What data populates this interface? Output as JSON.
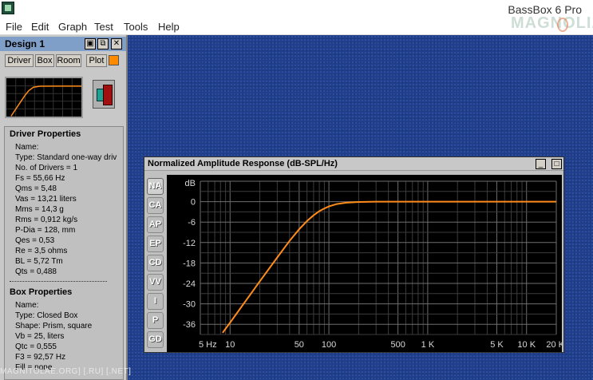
{
  "app": {
    "title": "BassBox 6 Pro",
    "watermark_logo": "MAGNOLIA"
  },
  "menu": [
    "File",
    "Edit",
    "Graph",
    "Test",
    "Tools",
    "Help"
  ],
  "design_panel": {
    "title": "Design 1",
    "window_buttons": [
      "▣",
      "⧉",
      "✕"
    ],
    "tabs": [
      "Driver",
      "Box",
      "Room",
      "Plot"
    ],
    "plot_color": "#ff8a00"
  },
  "driver_properties": {
    "heading": "Driver Properties",
    "lines": [
      "Name:",
      "Type: Standard one-way driv",
      "No. of Drivers = 1",
      "Fs = 55,66 Hz",
      "Qms = 5,48",
      "Vas = 13,21 liters",
      "Mms = 14,3 g",
      "Rms = 0,912 kg/s",
      "P-Dia = 128, mm",
      "Qes = 0,53",
      "Re = 3,5 ohms",
      "BL = 5,72 Tm",
      "Qts = 0,488"
    ]
  },
  "box_properties": {
    "heading": "Box Properties",
    "lines": [
      "Name:",
      "Type: Closed Box",
      "Shape: Prism, square",
      "Vb = 25, liters",
      "Qtc = 0,555",
      "F3 = 92,57 Hz",
      "Fill = none"
    ]
  },
  "footer_watermark": "MAGNITOLAE.ORG] [.RU] [.NET]",
  "graph_window": {
    "title": "Normalized Amplitude Response (dB-SPL/Hz)",
    "window_buttons": [
      "_",
      "□",
      "✕"
    ],
    "side_tabs": [
      "NA",
      "CA",
      "AP",
      "EP",
      "CD",
      "VV",
      "I",
      "P",
      "GD"
    ],
    "active_tab": "NA"
  },
  "chart_data": {
    "type": "line",
    "title": "Normalized Amplitude Response (dB-SPL/Hz)",
    "x_scale": "log",
    "xlim": [
      5,
      20000
    ],
    "ylim": [
      -39,
      6
    ],
    "x_tick_labels": [
      {
        "value": 5,
        "label": "5 Hz"
      },
      {
        "value": 10,
        "label": "10"
      },
      {
        "value": 50,
        "label": "50"
      },
      {
        "value": 100,
        "label": "100"
      },
      {
        "value": 500,
        "label": "500"
      },
      {
        "value": 1000,
        "label": "1 K"
      },
      {
        "value": 5000,
        "label": "5 K"
      },
      {
        "value": 10000,
        "label": "10 K"
      },
      {
        "value": 20000,
        "label": "20 K"
      }
    ],
    "y_unit_label": "dB",
    "y_ticks": [
      0,
      -6,
      -12,
      -18,
      -24,
      -30,
      -36
    ],
    "y_tick_labels": [
      "0",
      "-6",
      "-12",
      "-18",
      "-24",
      "-30",
      "-36"
    ],
    "grid": true,
    "line_color": "#ff8c1a",
    "series": [
      {
        "x": [
          8.4,
          10,
          15,
          20,
          30,
          40,
          50,
          60,
          70,
          80,
          90,
          100,
          120,
          150,
          200,
          300,
          500,
          1000,
          5000,
          10000,
          20000
        ],
        "y": [
          -38.5,
          -35.5,
          -28.4,
          -23.4,
          -16.4,
          -11.5,
          -8.1,
          -5.7,
          -4.0,
          -2.8,
          -2.0,
          -1.4,
          -0.7,
          -0.3,
          -0.1,
          0,
          0,
          0,
          0,
          0,
          0
        ]
      }
    ],
    "mini_series": {
      "x": [
        8.4,
        20,
        40,
        60,
        100,
        200,
        1000,
        20000
      ],
      "y": [
        -38.5,
        -23.4,
        -11.5,
        -5.7,
        -1.4,
        -0.1,
        0,
        0
      ]
    }
  }
}
